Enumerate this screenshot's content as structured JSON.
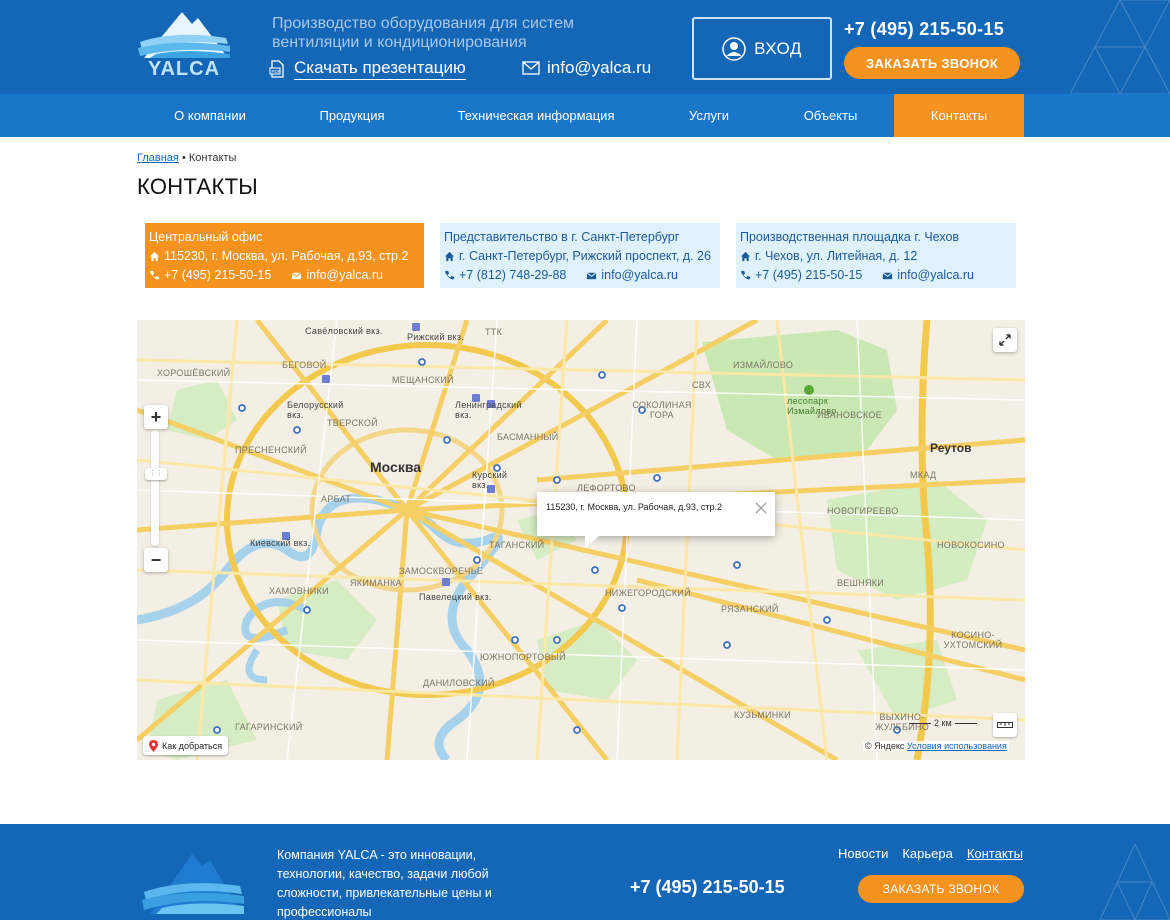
{
  "header": {
    "logo_text": "YALCA",
    "tagline": "Производство оборудования для систем вентиляции и кондиционирования",
    "download_label": "Скачать презентацию",
    "email": "info@yalca.ru",
    "login_label": "ВХОД",
    "phone": "+7 (495) 215-50-15",
    "callback_label": "ЗАКАЗАТЬ ЗВОНОК"
  },
  "nav": {
    "items": [
      {
        "label": "О компании"
      },
      {
        "label": "Продукция"
      },
      {
        "label": "Техническая информация"
      },
      {
        "label": "Услуги"
      },
      {
        "label": "Объекты"
      },
      {
        "label": "Контакты"
      }
    ],
    "active_index": 5
  },
  "breadcrumb": {
    "home": "Главная",
    "separator": "•",
    "current": "Контакты"
  },
  "page_title": "КОНТАКТЫ",
  "offices": [
    {
      "title": "Центральный офис",
      "address": "115230, г. Москва, ул. Рабочая, д.93, стр.2",
      "phone": "+7 (495) 215-50-15",
      "email": "info@yalca.ru"
    },
    {
      "title": "Представительство в г. Санкт-Петербург",
      "address": "г. Санкт-Петербург, Рижский проспект, д. 26",
      "phone": "+7 (812) 748-29-88",
      "email": "info@yalca.ru"
    },
    {
      "title": "Производственная площадка г. Чехов",
      "address": "г. Чехов, ул. Литейная, д. 12",
      "phone": "+7 (495) 215-50-15",
      "email": "info@yalca.ru"
    }
  ],
  "map": {
    "city": "Москва",
    "reutov": "Реутов",
    "balloon_text": "115230, г. Москва, ул. Рабочая, д.93, стр.2",
    "route_label": "Как добраться",
    "scale_label": "2 км",
    "copyright": "© Яндекс",
    "terms": "Условия использования",
    "park": "лесопарк Измайлово",
    "labels": {
      "savelovsky": "Савёловский вкз.",
      "rizhsky": "Рижский вкз.",
      "khoroshevsky": "ХОРОШЁВСКИЙ",
      "begovoy": "БЕГОВОЙ",
      "meshchansky": "МЕЩАНСКИЙ",
      "izmaylovo": "ИЗМАЙЛОВО",
      "belorussky": "Белорусский вкз.",
      "leningradsky": "Ленинградский вкз.",
      "sokolinaya": "СОКОЛИНАЯ ГОРА",
      "ivanovskoye": "ИВАНОВСКОЕ",
      "tverskoy": "ТВЕРСКОЙ",
      "basmanny": "БАСМАННЫЙ",
      "presnensky": "ПРЕСНЕНСКИЙ",
      "kursky": "Курский вкз.",
      "lefortovo": "ЛЕФОРТОВО",
      "novogireevo": "НОВОГИРЕЕВО",
      "arbat": "АРБАТ",
      "kievsky": "Киевский вкз.",
      "tagansky": "ТАГАНСКИЙ",
      "novokosino": "НОВОКОСИНО",
      "zamoskvorechye": "ЗАМОСКВОРЕЧЬЕ",
      "yakimanka": "ЯКИМАНКА",
      "khamovniki": "ХАМОВНИКИ",
      "paveletsky": "Павелецкий вкз.",
      "nizhegorodsky": "НИЖЕГОРОДСКИЙ",
      "veshnyaki": "ВЕШНЯКИ",
      "ryazansky": "РЯЗАНСКИЙ",
      "kosino": "КОСИНО-УХТОМСКИЙ",
      "yuzhnoportovy": "ЮЖНОПОРТОВЫЙ",
      "danilovsky": "ДАНИЛОВСКИЙ",
      "gagarinsky": "ГАГАРИНСКИЙ",
      "kuzminki": "КУЗЬМИНКИ",
      "vykhino": "ВЫХИНО-ЖУЛЕБИНО",
      "ttk": "ТТК",
      "svkh": "СВХ",
      "mkad": "МКАД"
    }
  },
  "footer": {
    "about": "Компания YALCA - это инновации, технологии, качество, задачи любой сложности, привлекательные цены и профессионалы",
    "phone": "+7 (495) 215-50-15",
    "links": [
      {
        "label": "Новости"
      },
      {
        "label": "Карьера"
      },
      {
        "label": "Контакты"
      }
    ],
    "callback_label": "ЗАКАЗАТЬ ЗВОНОК"
  },
  "colors": {
    "header_blue": "#1466b6",
    "nav_blue": "#1976c9",
    "accent_orange": "#f6921e",
    "card_light": "#dff2fc"
  }
}
